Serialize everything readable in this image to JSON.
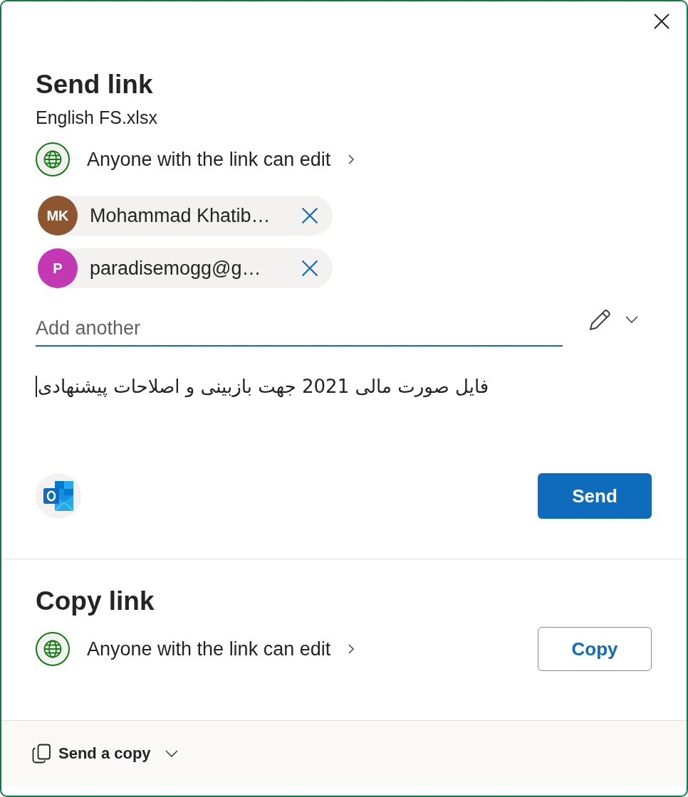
{
  "send_link": {
    "title": "Send link",
    "file_name": "English FS.xlsx",
    "permission": "Anyone with the link can edit",
    "recipients": [
      {
        "initials": "MK",
        "name": "Mohammad Khatib…",
        "color": "#8e562e"
      },
      {
        "initials": "P",
        "name": "paradisemogg@g…",
        "color": "#c239b3"
      }
    ],
    "add_recipient": {
      "placeholder": "Add another"
    },
    "message": "فایل صورت مالی 2021 جهت بازبینی و اصلاحات پیشنهادی",
    "send_button": "Send"
  },
  "copy_link": {
    "title": "Copy link",
    "permission": "Anyone with the link can edit",
    "copy_button": "Copy"
  },
  "footer": {
    "send_a_copy": "Send a copy"
  }
}
